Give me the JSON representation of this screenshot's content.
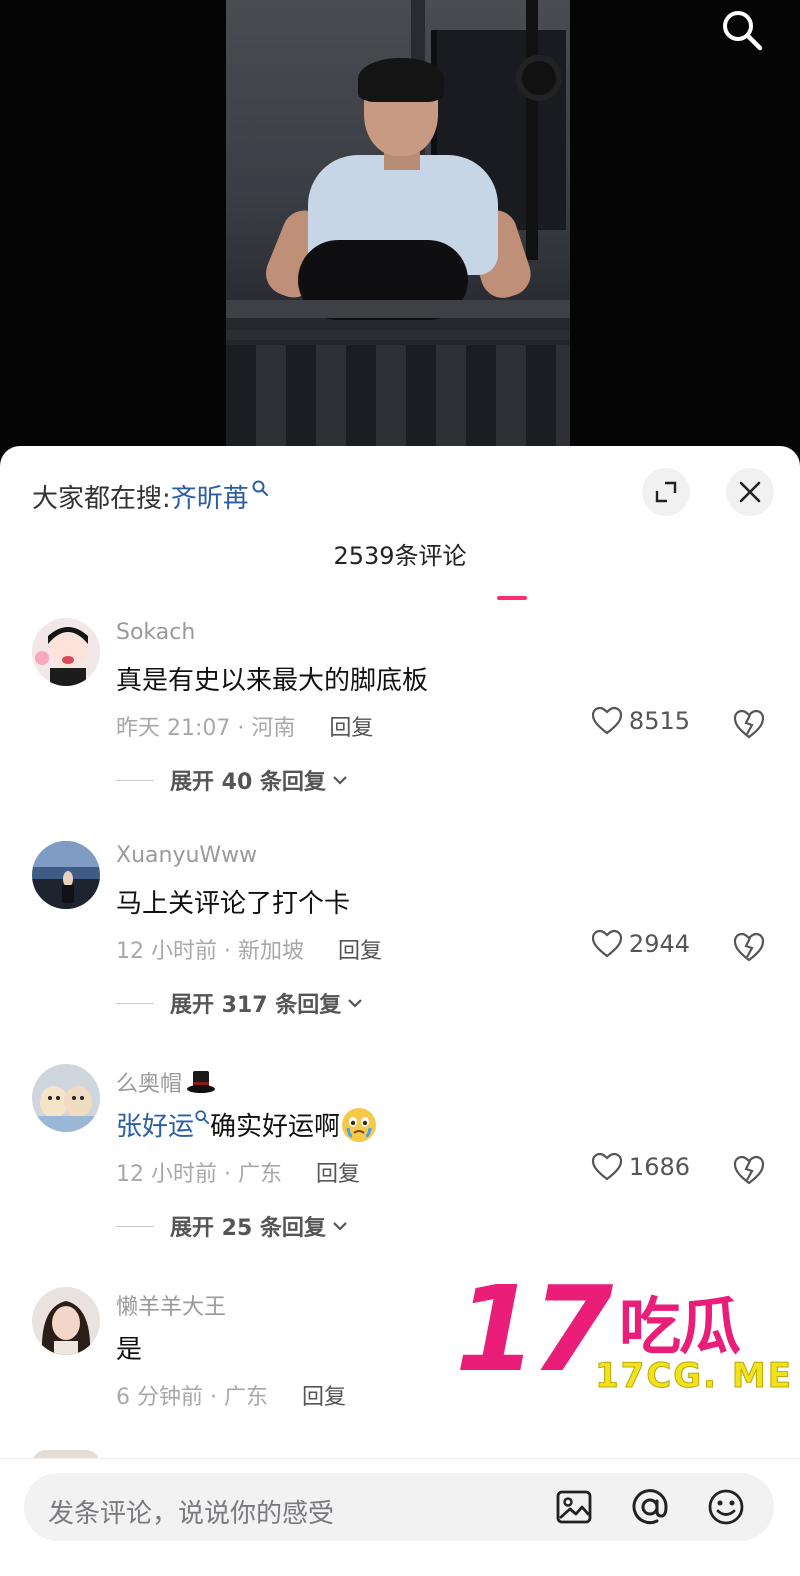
{
  "search_bar": {
    "prefix": "大家都在搜:",
    "term": "齐昕苒"
  },
  "comment_count": "2539条评论",
  "comments": [
    {
      "username": "Sokach",
      "text": "真是有史以来最大的脚底板",
      "time": "昨天 21:07 · 河南",
      "reply_label": "回复",
      "likes": "8515",
      "expand": "展开 40 条回复"
    },
    {
      "username": "XuanyuWww",
      "text": "马上关评论了打个卡",
      "time": "12 小时前 · 新加坡",
      "reply_label": "回复",
      "likes": "2944",
      "expand": "展开 317 条回复"
    },
    {
      "username": "么奥帽",
      "link": "张好运",
      "text": "确实好运啊",
      "time": "12 小时前 · 广东",
      "reply_label": "回复",
      "likes": "1686",
      "expand": "展开 25 条回复"
    },
    {
      "username": "懒羊羊大王",
      "text": "是",
      "time": "6 分钟前 · 广东",
      "reply_label": "回复"
    }
  ],
  "input": {
    "placeholder": "发条评论，说说你的感受"
  },
  "watermark": {
    "big": "17",
    "cn": "吃瓜",
    "url": "17CG. ME"
  },
  "icons": [
    "search-icon",
    "expand-icon",
    "close-icon",
    "heart-icon",
    "dislike-icon",
    "chevron-down-icon",
    "image-icon",
    "at-icon",
    "emoji-icon"
  ],
  "colors": {
    "accent_link": "#2a5fa6",
    "watermark_pink": "#ea1e78",
    "watermark_yellow": "#f3e21a",
    "indicator": "#ff2c6e"
  }
}
